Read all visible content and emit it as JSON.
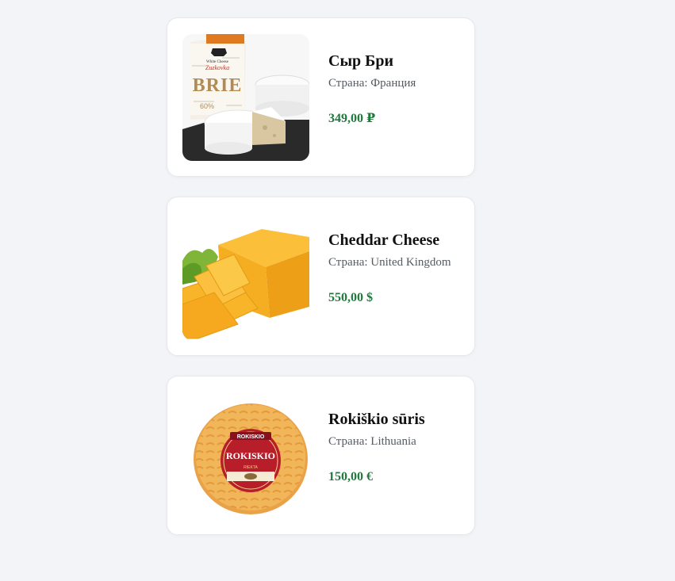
{
  "products": [
    {
      "name": "Сыр Бри",
      "country_prefix": "Страна: ",
      "country": "Франция",
      "country_line": "Страна: Франция",
      "price": "349,00 ₽",
      "image_icon": "brie-cheese-image",
      "package_text": "BRIE",
      "package_brand": "Zuzkovka",
      "package_brand_small": "White Cheese",
      "package_fat": "60%"
    },
    {
      "name": "Cheddar Cheese",
      "country_prefix": "Страна: ",
      "country": "United Kingdom",
      "country_line": "Страна: United Kingdom",
      "price": "550,00 $",
      "image_icon": "cheddar-cheese-image"
    },
    {
      "name": "Rokiškio sūris",
      "country_prefix": "Страна: ",
      "country": "Lithuania",
      "country_line": "Страна: Lithuania",
      "price": "150,00 €",
      "image_icon": "rokiskio-cheese-image",
      "label_top": "ROKISKIO",
      "label_main": "ROKISKIO",
      "label_sub": "RIEKTA"
    }
  ],
  "colors": {
    "background": "#f3f4f7",
    "card": "#ffffff",
    "price": "#1f7a3c",
    "country": "#555a61"
  }
}
